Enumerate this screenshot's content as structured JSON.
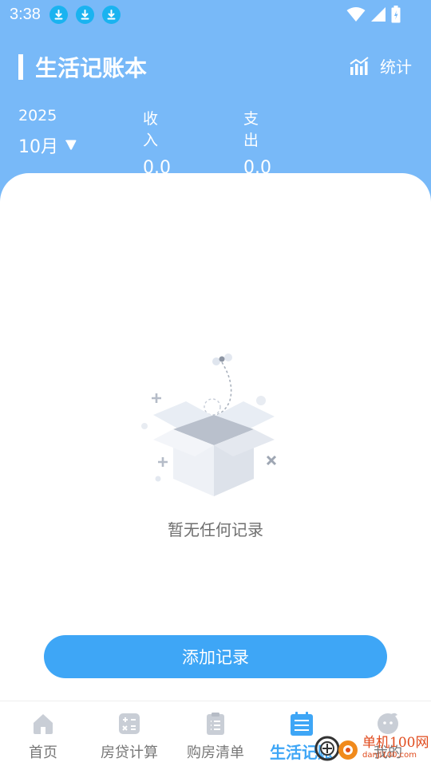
{
  "status_bar": {
    "time": "3:38",
    "download_icons": 3
  },
  "header": {
    "title": "生活记账本",
    "stats_label": "统计",
    "year": "2025",
    "month": "10月",
    "income_label": "收入",
    "income_value": "0.0",
    "expense_label": "支出",
    "expense_value": "0.0",
    "accent": "#78b9f8"
  },
  "main": {
    "empty_text": "暂无任何记录",
    "add_button_label": "添加记录",
    "button_color": "#3ea6f6"
  },
  "tabs": [
    {
      "label": "首页",
      "icon": "home-icon",
      "active": false
    },
    {
      "label": "房贷计算",
      "icon": "calculator-icon",
      "active": false
    },
    {
      "label": "购房清单",
      "icon": "clipboard-icon",
      "active": false
    },
    {
      "label": "生活记账",
      "icon": "calendar-icon",
      "active": true
    },
    {
      "label": "我的",
      "icon": "profile-icon",
      "active": false
    }
  ],
  "watermark": {
    "text": "单机100网",
    "subtext": "danji100.com"
  }
}
